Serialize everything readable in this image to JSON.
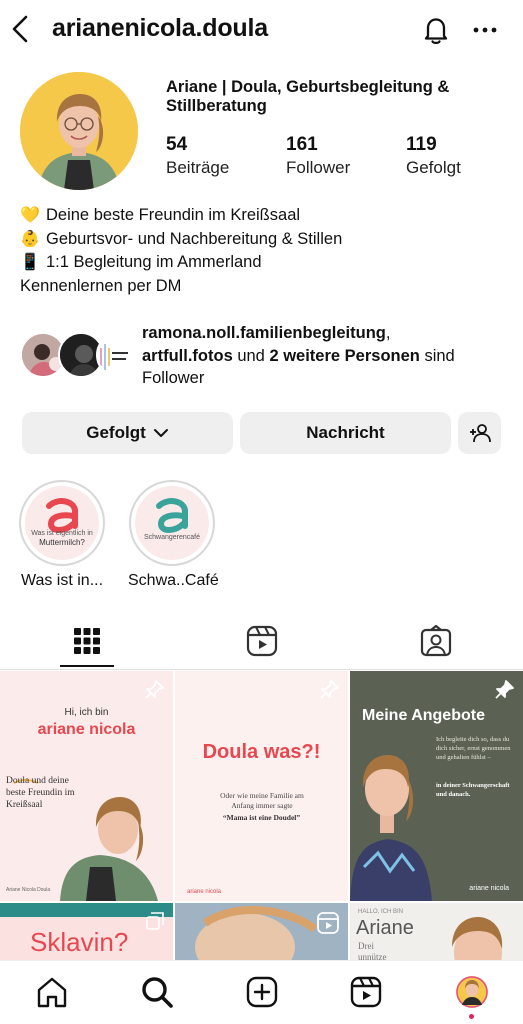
{
  "header": {
    "username": "arianenicola.doula",
    "icons": {
      "back": "chevron-left-icon",
      "notifications": "bell-icon",
      "more": "more-icon"
    }
  },
  "profile": {
    "full_name": "Ariane | Doula, Geburtsbegleitung & Stillberatung",
    "stats": [
      {
        "value": "54",
        "label": "Beiträge"
      },
      {
        "value": "161",
        "label": "Follower"
      },
      {
        "value": "119",
        "label": "Gefolgt"
      }
    ],
    "bio": [
      {
        "emoji": "💛",
        "text": "Deine beste Freundin im Kreißsaal"
      },
      {
        "emoji": "👶",
        "text": "Geburtsvor- und Nachbereitung & Stillen"
      },
      {
        "emoji": "📱",
        "text": "1:1 Begleitung im Ammerland"
      },
      {
        "emoji": "",
        "text": "Kennenlernen per DM"
      }
    ],
    "followed_by": {
      "name1": "ramona.noll.familienbegleitung",
      "sep1": ",",
      "name2": "artfull.fotos",
      "mid": " und ",
      "others": "2 weitere Personen",
      "end": " sind Follower"
    }
  },
  "buttons": {
    "following": "Gefolgt",
    "message": "Nachricht"
  },
  "highlights": [
    {
      "caption": "Was ist in...",
      "inner_text": "Muttermilch?",
      "small_text": "Was ist eigentlich in",
      "accent": "#e8474f"
    },
    {
      "caption": "Schwa..Café",
      "inner_text": "",
      "small_text": "Schwangerencafé",
      "accent": "#3aa39a"
    }
  ],
  "posts": [
    {
      "id": "p1",
      "line1": "Hi, ich bin",
      "line2": "ariane nicola",
      "line3": "Doula und deine beste Freundin im Kreißsaal",
      "footer": "Ariane Nicola Doula",
      "pinned": true
    },
    {
      "id": "p2",
      "title": "Doula was?!",
      "sub": "Oder wie meine Familie am Anfang immer sagte",
      "quote": "“Mama ist eine Doudel”",
      "footer": "ariane nicola",
      "pinned": true
    },
    {
      "id": "p3",
      "title": "Meine Angebote",
      "text_a": "Ich begleite dich so, dass du dich sicher, ernst genommen und gehalten fühlst –",
      "text_b": "in deiner Schwangerschaft und danach.",
      "footer": "ariane nicola",
      "pinned": true
    },
    {
      "id": "p4",
      "title": "Sklavin?"
    },
    {
      "id": "p5",
      "title": ""
    },
    {
      "id": "p6",
      "small": "HALLO, ICH BIN",
      "title": "Ariane",
      "sub": "Drei unnütze"
    }
  ],
  "colors": {
    "accent_red": "#e8474f",
    "accent_teal": "#3aa39a",
    "post_green": "#5b6253",
    "post_pink": "#fbebea"
  },
  "bottom_nav": [
    "home-icon",
    "search-icon",
    "create-icon",
    "reels-icon",
    "profile-avatar"
  ]
}
